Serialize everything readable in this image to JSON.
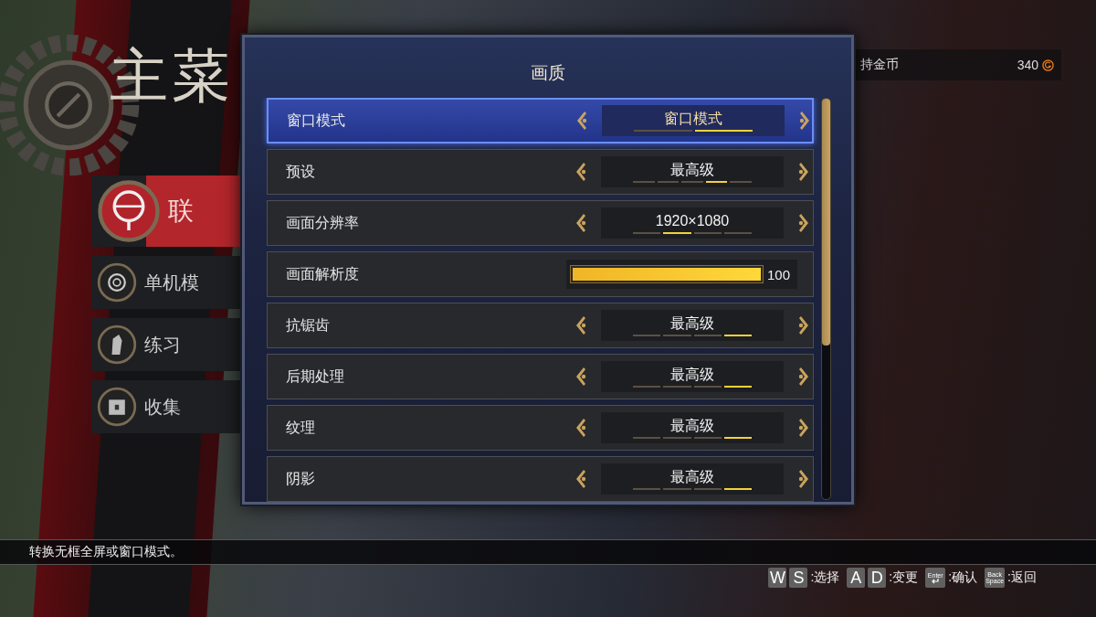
{
  "main_menu": {
    "title": "主菜",
    "items": [
      {
        "label": "联",
        "selected": true
      },
      {
        "label": "单机模",
        "selected": false
      },
      {
        "label": "练习",
        "selected": false
      },
      {
        "label": "收集",
        "selected": false
      }
    ]
  },
  "gold": {
    "label": "持金币",
    "amount": "340"
  },
  "dialog": {
    "title": "画质",
    "settings": [
      {
        "kind": "selector",
        "label": "窗口模式",
        "value": "窗口模式",
        "selected": true,
        "pips": [
          {
            "selected": false
          },
          {
            "selected": true
          }
        ]
      },
      {
        "kind": "selector",
        "label": "预设",
        "value": "最高级",
        "selected": false,
        "pips": [
          {
            "selected": false
          },
          {
            "selected": false
          },
          {
            "selected": false
          },
          {
            "selected": true
          },
          {
            "selected": false
          }
        ]
      },
      {
        "kind": "selector",
        "label": "画面分辨率",
        "value": "1920×1080",
        "selected": false,
        "pips": [
          {
            "selected": false
          },
          {
            "selected": true
          },
          {
            "selected": false
          },
          {
            "selected": false
          }
        ]
      },
      {
        "kind": "slider",
        "label": "画面解析度",
        "level": 1,
        "reading": "100",
        "selected": false
      },
      {
        "kind": "selector",
        "label": "抗锯齿",
        "value": "最高级",
        "selected": false,
        "pips": [
          {
            "selected": false
          },
          {
            "selected": false
          },
          {
            "selected": false
          },
          {
            "selected": true
          }
        ]
      },
      {
        "kind": "selector",
        "label": "后期处理",
        "value": "最高级",
        "selected": false,
        "pips": [
          {
            "selected": false
          },
          {
            "selected": false
          },
          {
            "selected": false
          },
          {
            "selected": true
          }
        ]
      },
      {
        "kind": "selector",
        "label": "纹理",
        "value": "最高级",
        "selected": false,
        "pips": [
          {
            "selected": false
          },
          {
            "selected": false
          },
          {
            "selected": false
          },
          {
            "selected": true
          }
        ]
      },
      {
        "kind": "selector",
        "label": "阴影",
        "value": "最高级",
        "selected": false,
        "pips": [
          {
            "selected": false
          },
          {
            "selected": false
          },
          {
            "selected": false
          },
          {
            "selected": true
          }
        ]
      }
    ]
  },
  "description": "转换无框全屏或窗口模式。",
  "hints": [
    {
      "keys": [
        {
          "kind": "letter",
          "label": "W"
        },
        {
          "kind": "letter",
          "label": "S"
        }
      ],
      "action": ":选择"
    },
    {
      "keys": [
        {
          "kind": "letter",
          "label": "A"
        },
        {
          "kind": "letter",
          "label": "D"
        }
      ],
      "action": ":变更"
    },
    {
      "keys": [
        {
          "kind": "enter",
          "label": "Enter"
        }
      ],
      "action": ":确认"
    },
    {
      "keys": [
        {
          "kind": "small",
          "label": "Back Space"
        }
      ],
      "action": ":返回"
    }
  ]
}
